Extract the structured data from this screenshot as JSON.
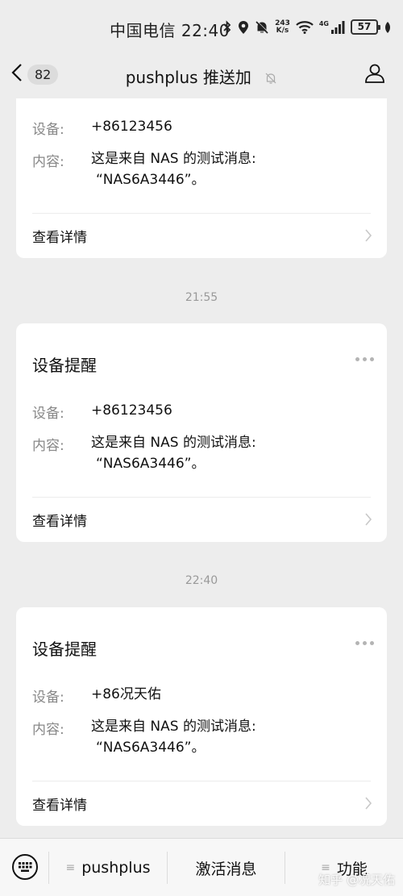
{
  "status_bar": {
    "carrier_time": "中国电信 22:40",
    "net_speed_value": "243",
    "net_speed_unit": "K/s",
    "signal_label": "4G",
    "battery": "57"
  },
  "nav": {
    "unread_count": "82",
    "title": "pushplus 推送加"
  },
  "messages": [
    {
      "title": "",
      "device_label": "设备:",
      "device_value": "+86123456",
      "content_label": "内容:",
      "content_line1": "这是来自 NAS 的测试消息:",
      "content_line2": "“NAS6A3446”。",
      "detail_label": "查看详情"
    },
    {
      "time": "21:55",
      "title": "设备提醒",
      "device_label": "设备:",
      "device_value": "+86123456",
      "content_label": "内容:",
      "content_line1": "这是来自 NAS 的测试消息:",
      "content_line2": "“NAS6A3446”。",
      "detail_label": "查看详情"
    },
    {
      "time": "22:40",
      "title": "设备提醒",
      "device_label": "设备:",
      "device_value": "+86况天佑",
      "content_label": "内容:",
      "content_line1": "这是来自 NAS 的测试消息:",
      "content_line2": "“NAS6A3446”。",
      "detail_label": "查看详情"
    }
  ],
  "bottom_menu": {
    "item1": "pushplus",
    "item2": "激活消息",
    "item3": "功能",
    "watermark": "知乎 @况天佑"
  }
}
